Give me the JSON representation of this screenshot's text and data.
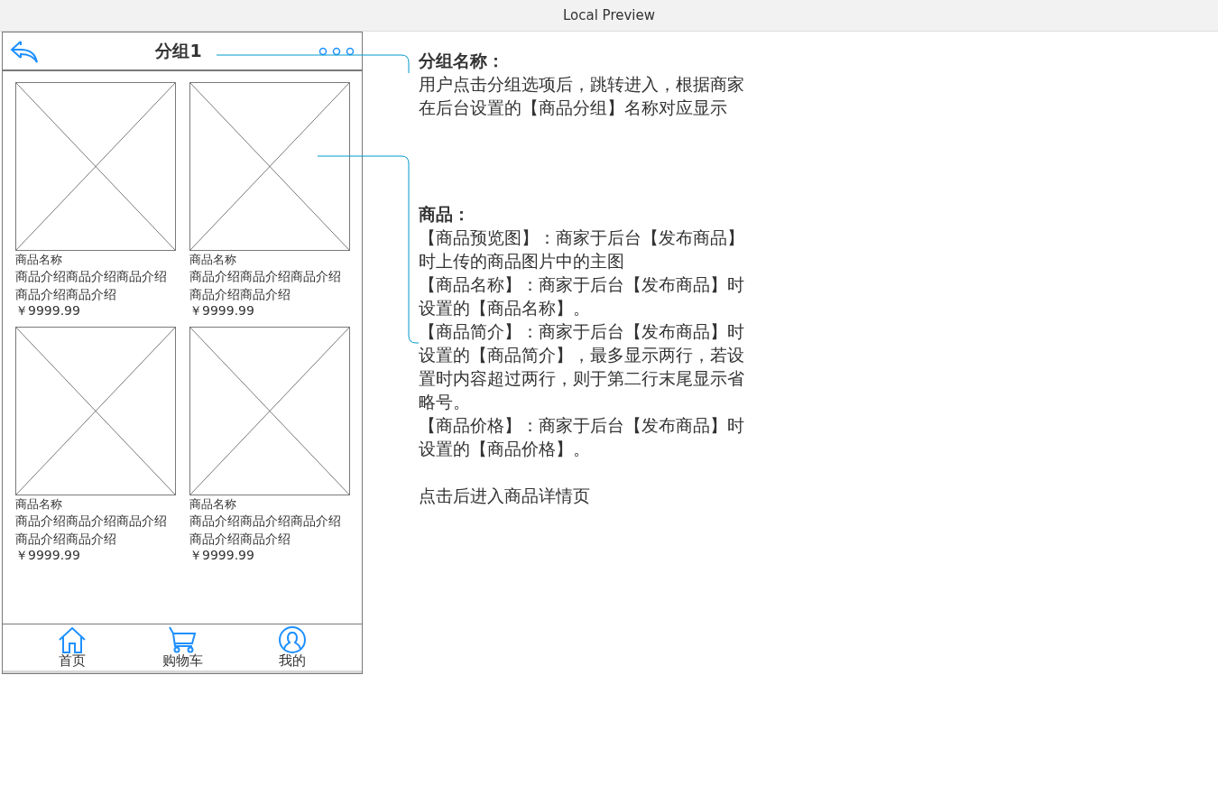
{
  "window": {
    "title": "Local Preview"
  },
  "header": {
    "title": "分组1"
  },
  "products": [
    {
      "name": "商品名称",
      "description": "商品介绍商品介绍商品介绍商品介绍商品介绍",
      "price": "￥9999.99"
    },
    {
      "name": "商品名称",
      "description": "商品介绍商品介绍商品介绍商品介绍商品介绍",
      "price": "￥9999.99"
    },
    {
      "name": "商品名称",
      "description": "商品介绍商品介绍商品介绍商品介绍商品介绍",
      "price": "￥9999.99"
    },
    {
      "name": "商品名称",
      "description": "商品介绍商品介绍商品介绍商品介绍商品介绍",
      "price": "￥9999.99"
    }
  ],
  "tab_bar": {
    "items": [
      {
        "kind": "home",
        "label": "首页"
      },
      {
        "kind": "cart",
        "label": "购物车"
      },
      {
        "kind": "user",
        "label": "我的"
      }
    ]
  },
  "annotations": [
    {
      "title": "分组名称：",
      "paragraphs": [
        "用户点击分组选项后，跳转进入，根据商家在后台设置的【商品分组】名称对应显示"
      ]
    },
    {
      "title": "商品：",
      "paragraphs": [
        "【商品预览图】：商家于后台【发布商品】时上传的商品图片中的主图",
        "【商品名称】：商家于后台【发布商品】时设置的【商品名称】。",
        "【商品简介】：商家于后台【发布商品】时设置的【商品简介】，最多显示两行，若设置时内容超过两行，则于第二行末尾显示省略号。",
        "【商品价格】：商家于后台【发布商品】时设置的【商品价格】。",
        "点击后进入商品详情页"
      ]
    }
  ]
}
